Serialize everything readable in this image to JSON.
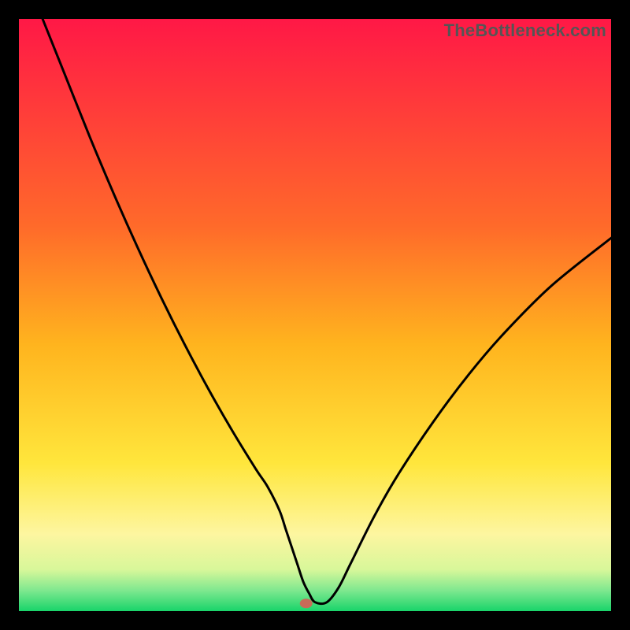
{
  "watermark": "TheBottleneck.com",
  "chart_data": {
    "type": "line",
    "title": "",
    "xlabel": "",
    "ylabel": "",
    "xlim": [
      0,
      100
    ],
    "ylim": [
      0,
      100
    ],
    "background_gradient_stops": [
      {
        "offset": 0,
        "color": "#ff1846"
      },
      {
        "offset": 0.35,
        "color": "#ff6a2a"
      },
      {
        "offset": 0.55,
        "color": "#ffb41e"
      },
      {
        "offset": 0.75,
        "color": "#ffe63c"
      },
      {
        "offset": 0.87,
        "color": "#fdf6a0"
      },
      {
        "offset": 0.93,
        "color": "#d8f79a"
      },
      {
        "offset": 0.965,
        "color": "#7fe88f"
      },
      {
        "offset": 1.0,
        "color": "#19d46a"
      }
    ],
    "series": [
      {
        "name": "bottleneck-curve",
        "stroke": "#000000",
        "stroke_width": 3,
        "x": [
          4,
          8,
          12,
          16,
          20,
          24,
          28,
          32,
          36,
          40,
          42,
          44,
          45,
          46,
          47,
          48,
          49,
          50,
          52,
          54,
          56,
          60,
          64,
          70,
          76,
          82,
          90,
          100
        ],
        "y": [
          100,
          90,
          80,
          70.5,
          61.5,
          53,
          45,
          37.5,
          30.5,
          24,
          21,
          17,
          14,
          11,
          8,
          5,
          3,
          1.5,
          1.5,
          4,
          8,
          16,
          23,
          32,
          40,
          47,
          55,
          63
        ]
      }
    ],
    "marker": {
      "name": "bottleneck-marker",
      "x": 48.5,
      "y": 1.3,
      "rx": 8,
      "ry": 6,
      "fill": "#c96a58"
    }
  }
}
